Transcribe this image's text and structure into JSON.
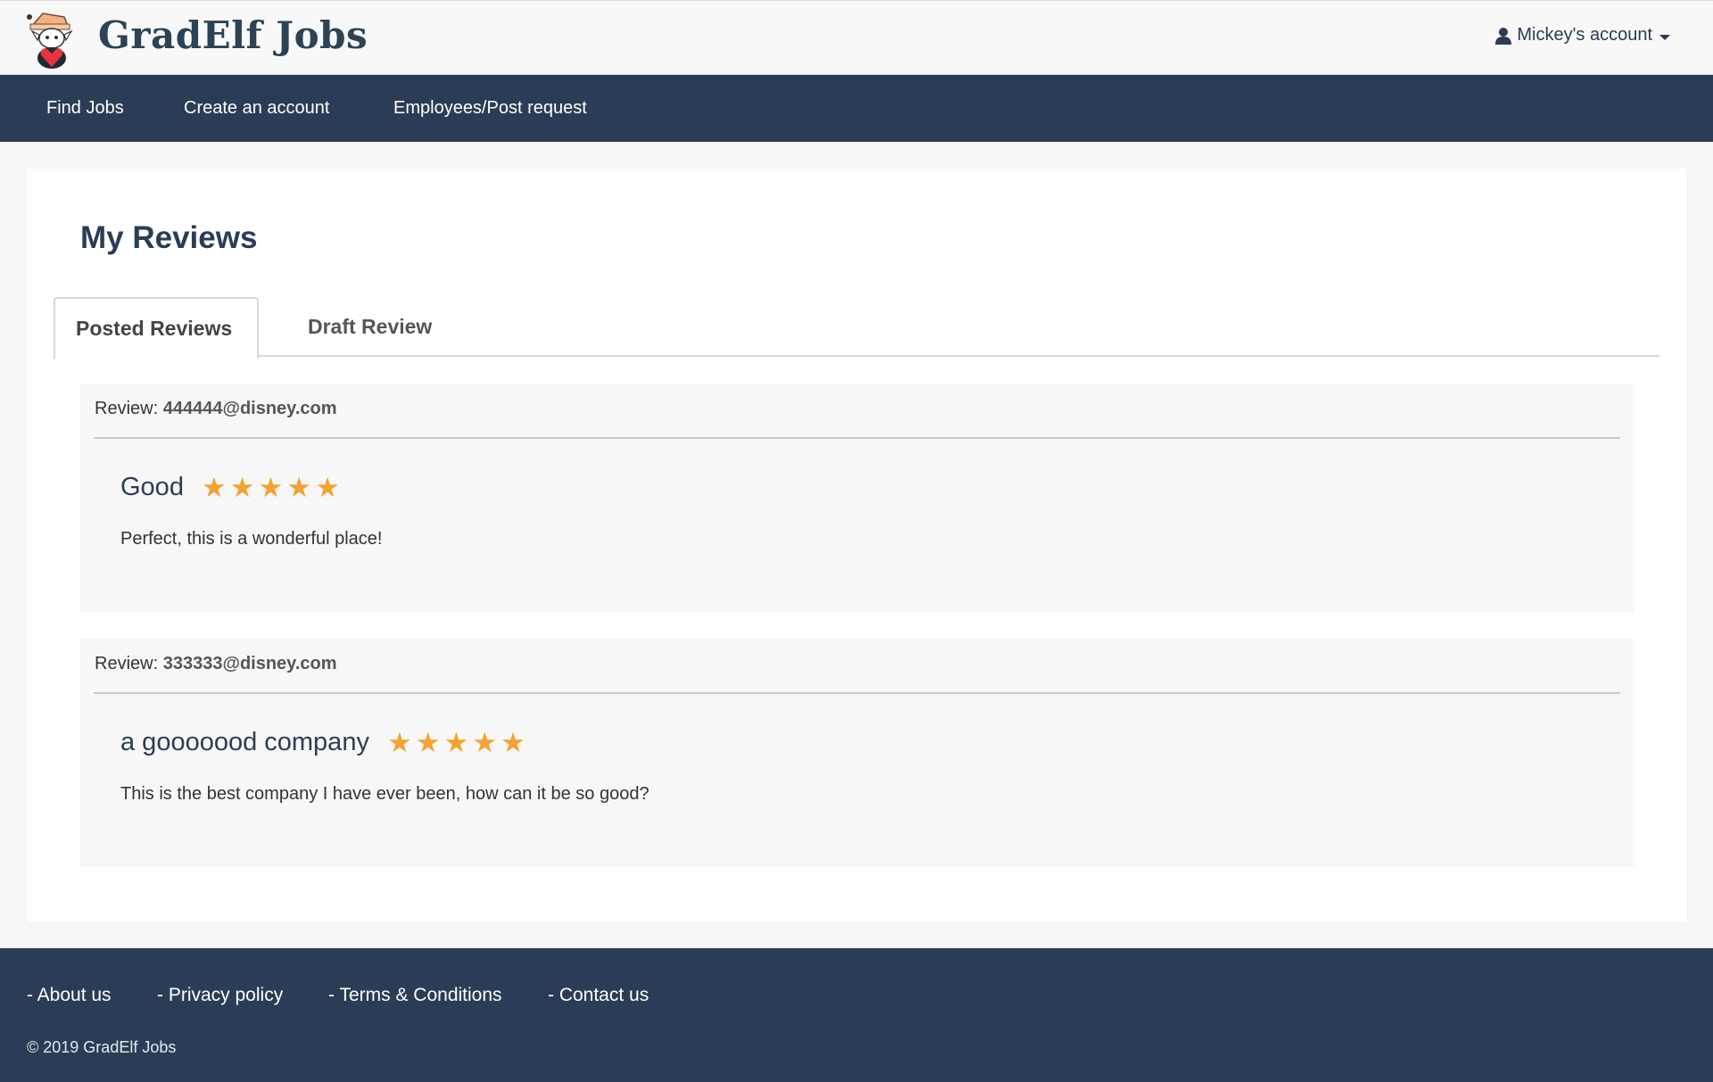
{
  "header": {
    "brand": "GradElf Jobs",
    "logo_icon": "elf-mascot-icon",
    "account_label": "Mickey's account",
    "account_icon": "user-icon"
  },
  "nav": {
    "items": [
      {
        "label": "Find Jobs"
      },
      {
        "label": "Create an account"
      },
      {
        "label": "Employees/Post request"
      }
    ]
  },
  "main": {
    "title": "My Reviews",
    "tabs": [
      {
        "label": "Posted Reviews",
        "active": true
      },
      {
        "label": "Draft Review",
        "active": false
      }
    ],
    "reviews": [
      {
        "prefix": "Review:",
        "email": "444444@disney.com",
        "title": "Good",
        "rating": 5,
        "max_rating": 5,
        "body": "Perfect, this is a wonderful place!"
      },
      {
        "prefix": "Review:",
        "email": "333333@disney.com",
        "title": "a gooooood company",
        "rating": 5,
        "max_rating": 5,
        "body": "This is the best company I have ever been, how can it be so good?"
      }
    ]
  },
  "footer": {
    "links": [
      {
        "label": "- About us"
      },
      {
        "label": "- Privacy policy"
      },
      {
        "label": "- Terms & Conditions"
      },
      {
        "label": "- Contact us"
      }
    ],
    "copyright": "© 2019 GradElf Jobs"
  },
  "colors": {
    "navy": "#2b3d56",
    "star": "#f3a233",
    "panel": "#f7f7f7"
  }
}
